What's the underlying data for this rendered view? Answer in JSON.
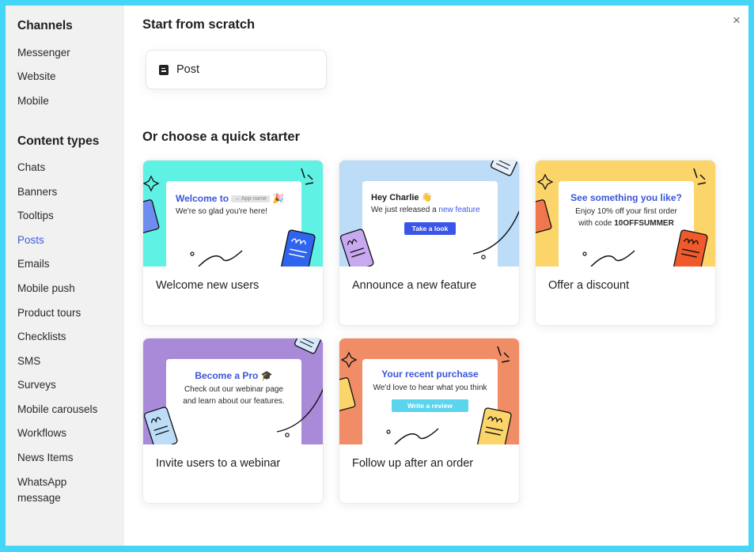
{
  "sidebar": {
    "channels_heading": "Channels",
    "channels": [
      {
        "label": "Messenger"
      },
      {
        "label": "Website"
      },
      {
        "label": "Mobile"
      }
    ],
    "content_types_heading": "Content types",
    "content_types": [
      {
        "label": "Chats"
      },
      {
        "label": "Banners"
      },
      {
        "label": "Tooltips"
      },
      {
        "label": "Posts",
        "active": true
      },
      {
        "label": "Emails"
      },
      {
        "label": "Mobile push"
      },
      {
        "label": "Product tours"
      },
      {
        "label": "Checklists"
      },
      {
        "label": "SMS"
      },
      {
        "label": "Surveys"
      },
      {
        "label": "Mobile carousels"
      },
      {
        "label": "Workflows"
      },
      {
        "label": "News Items"
      },
      {
        "label": "WhatsApp message"
      }
    ]
  },
  "main": {
    "close_icon": "×",
    "scratch_title": "Start from scratch",
    "scratch_option": {
      "label": "Post",
      "icon": "post-icon"
    },
    "starter_title": "Or choose a quick starter",
    "starters": [
      {
        "label": "Welcome new users",
        "bg": "#5ff2e4",
        "preview": {
          "heading": "Welcome to",
          "badge": "↔ App name",
          "emoji": "🎉",
          "text": "We're so glad you're here!"
        }
      },
      {
        "label": "Announce a new feature",
        "bg": "#bcdcf7",
        "preview": {
          "heading": "Hey Charlie",
          "emoji": "👋",
          "text_prefix": "We just released a ",
          "text_link": "new feature",
          "cta": "Take a look",
          "cta_color": "#3a55e8"
        }
      },
      {
        "label": "Offer a discount",
        "bg": "#fcd56a",
        "preview": {
          "heading": "See something you like?",
          "text": "Enjoy 10% off your first order",
          "text2_prefix": "with code ",
          "code": "10OFFSUMMER"
        }
      },
      {
        "label": "Invite users to a webinar",
        "bg": "#a98ad9",
        "preview": {
          "heading": "Become a Pro",
          "emoji": "🎓",
          "text": "Check out our webinar page",
          "text2": "and learn about our features."
        }
      },
      {
        "label": "Follow up after an order",
        "bg": "#f08d66",
        "preview": {
          "heading": "Your recent purchase",
          "text": "We'd love to hear what you think",
          "cta": "Write a review",
          "cta_color": "#5bd4ee"
        }
      }
    ]
  }
}
